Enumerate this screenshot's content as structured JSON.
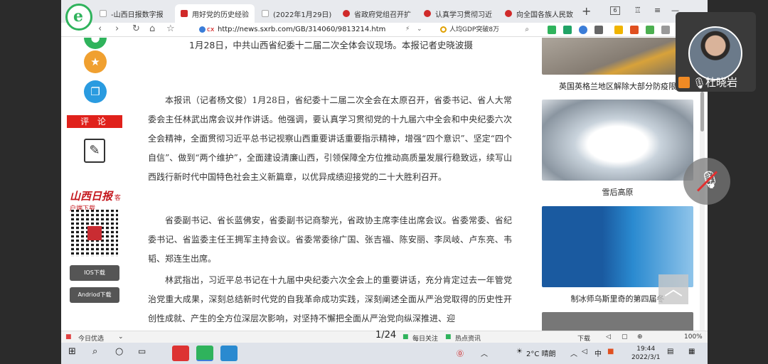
{
  "tabs": [
    {
      "label": "-山西日报数字报",
      "color": "#e04040",
      "active": false
    },
    {
      "label": "用好党的历史经验",
      "color": "#d02a2a",
      "active": true
    },
    {
      "label": "(2022年1月29日)",
      "color": "#888888",
      "active": false
    },
    {
      "label": "省政府党组召开扩",
      "color": "#d02a2a",
      "active": false
    },
    {
      "label": "认真学习贯彻习近",
      "color": "#d02a2a",
      "active": false
    },
    {
      "label": "向全国各族人民致",
      "color": "#d02a2a",
      "active": false
    }
  ],
  "tab_count": "6",
  "address_bar": {
    "url": "http://news.sxrb.com/GB/314060/9813214.htm",
    "cx_label": "cx"
  },
  "search_box": {
    "text": "人均GDP突破8万"
  },
  "sidebar": {
    "comment_label": "评 论",
    "brand_name": "山西日报",
    "brand_sub": "客户端下载",
    "ios_label": "IOS下载",
    "android_label": "Andriod下载"
  },
  "article": {
    "caption": "1月28日，中共山西省纪委十二届二次全体会议现场。本报记者史晓波摄",
    "paragraphs": [
      "本报讯（记者杨文俊）1月28日，省纪委十二届二次全会在太原召开，省委书记、省人大常委会主任林武出席会议并作讲话。他强调，要认真学习贯彻党的十九届六中全会和中央纪委六次全会精神，全面贯彻习近平总书记视察山西重要讲话重要指示精神，增强“四个意识”、坚定“四个自信”、做到“两个维护”，全面建设清廉山西，引领保障全方位推动高质量发展行稳致远，续写山西践行新时代中国特色社会主义新篇章，以优异成绩迎接党的二十大胜利召开。",
      "省委副书记、省长蓝佛安，省委副书记商黎光，省政协主席李佳出席会议。省委常委、省纪委书记、省监委主任王拥军主持会议。省委常委徐广国、张吉福、陈安丽、李凤岐、卢东亮、韦韬、郑连生出席。",
      "林武指出，习近平总书记在十九届中央纪委六次全会上的重要讲话，充分肯定过去一年管党治党重大成果，深刻总结新时代党的自我革命成功实践，深刻阐述全面从严治党取得的历史性开创性成就、产生的全方位深层次影响，对坚持不懈把全面从严治党向纵深推进、迎"
    ]
  },
  "related": [
    {
      "caption": "英国英格兰地区解除大部分防疫限"
    },
    {
      "caption": "雪后高原"
    },
    {
      "caption": "制冰师乌斯里奇的第四届冬"
    }
  ],
  "statusbar": {
    "today": "今日优选",
    "page_counter": "1/24",
    "daily": "每日关注",
    "hot": "热点资讯",
    "download": "下载",
    "zoom": "100%"
  },
  "meeting": {
    "participant_name": "杜晓岩"
  },
  "taskbar": {
    "weather": "2°C 晴朗",
    "time": "19:44",
    "date": "2022/3/1",
    "lang": "中"
  }
}
